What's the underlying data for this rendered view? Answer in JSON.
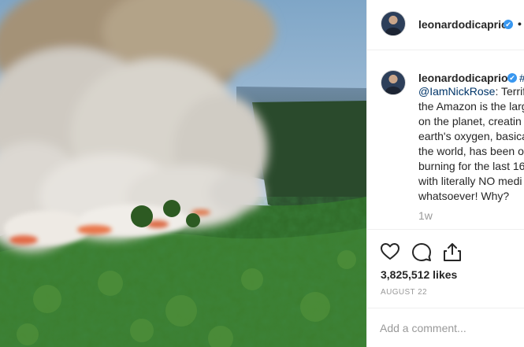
{
  "post": {
    "username": "leonardodicaprio",
    "more_label": "•",
    "verified_label": "✔",
    "image_alt": "Aerial view of Amazon rainforest burning"
  },
  "caption": {
    "username": "leonardodicaprio",
    "hashtag_prefix": "#",
    "lines": [
      {
        "mention": "@IamNickRose",
        "text": ": Terrify"
      },
      {
        "mention": "",
        "text": "the Amazon is the larg"
      },
      {
        "mention": "",
        "text": "on the planet, creatin"
      },
      {
        "mention": "",
        "text": "earth's oxygen, basica"
      },
      {
        "mention": "",
        "text": "the world, has been o"
      },
      {
        "mention": "",
        "text": "burning for the last 16"
      },
      {
        "mention": "",
        "text": "with literally NO medi"
      },
      {
        "mention": "",
        "text": "whatsoever! Why?"
      }
    ]
  },
  "time_ago": "1w",
  "actions": {
    "like_icon": "heart-icon",
    "comment_icon": "comment-icon",
    "share_icon": "share-icon"
  },
  "likes_text": "3,825,512 likes",
  "date_text": "AUGUST 22",
  "comment": {
    "placeholder": "Add a comment...",
    "value": ""
  },
  "colors": {
    "text": "#262626",
    "muted": "#999999",
    "link": "#003569",
    "verified": "#3897f0",
    "divider": "#efefef"
  }
}
